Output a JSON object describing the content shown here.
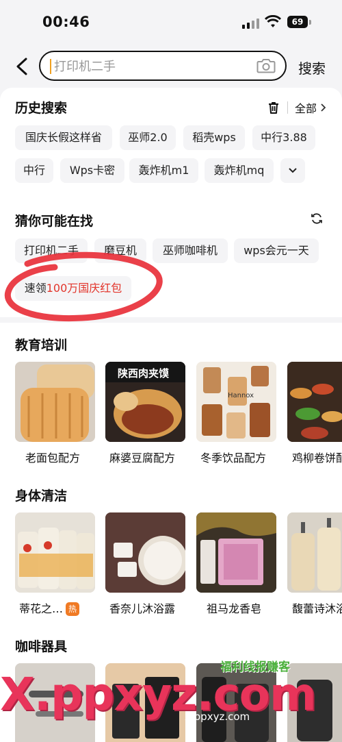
{
  "status_bar": {
    "time": "00:46",
    "battery": "69"
  },
  "search": {
    "placeholder": "打印机二手",
    "button_label": "搜索"
  },
  "history": {
    "title": "历史搜索",
    "all_label": "全部",
    "items": [
      "国庆长假这样省",
      "巫师2.0",
      "稻壳wps",
      "中行3.88",
      "中行",
      "Wps卡密",
      "轰炸机m1",
      "轰炸机mq"
    ]
  },
  "guess": {
    "title": "猜你可能在找",
    "items": [
      "打印机二手",
      "磨豆机",
      "巫师咖啡机",
      "wps会元一天"
    ],
    "promo_prefix": "速领",
    "promo_highlight": "100万国庆红包"
  },
  "categories": [
    {
      "title": "教育培训",
      "items": [
        {
          "label": "老面包配方",
          "image_text": ""
        },
        {
          "label": "麻婆豆腐配方",
          "image_text": "陕西肉夹馍"
        },
        {
          "label": "冬季饮品配方",
          "image_text": "Hannox"
        },
        {
          "label": "鸡柳卷饼配",
          "image_text": ""
        }
      ]
    },
    {
      "title": "身体清洁",
      "items": [
        {
          "label": "蒂花之…",
          "badge": "热"
        },
        {
          "label": "香奈儿沐浴露"
        },
        {
          "label": "祖马龙香皂"
        },
        {
          "label": "馥蕾诗沐浴"
        }
      ]
    },
    {
      "title": "咖啡器具",
      "items": []
    }
  ],
  "watermark": {
    "big": "X.ppxyz.com",
    "small": "x.ppxyz.com",
    "badge": "福利线报赚客"
  },
  "colors": {
    "accent_red": "#e2342a",
    "hot_orange": "#f07a24",
    "watermark_pink": "#e8345a"
  }
}
